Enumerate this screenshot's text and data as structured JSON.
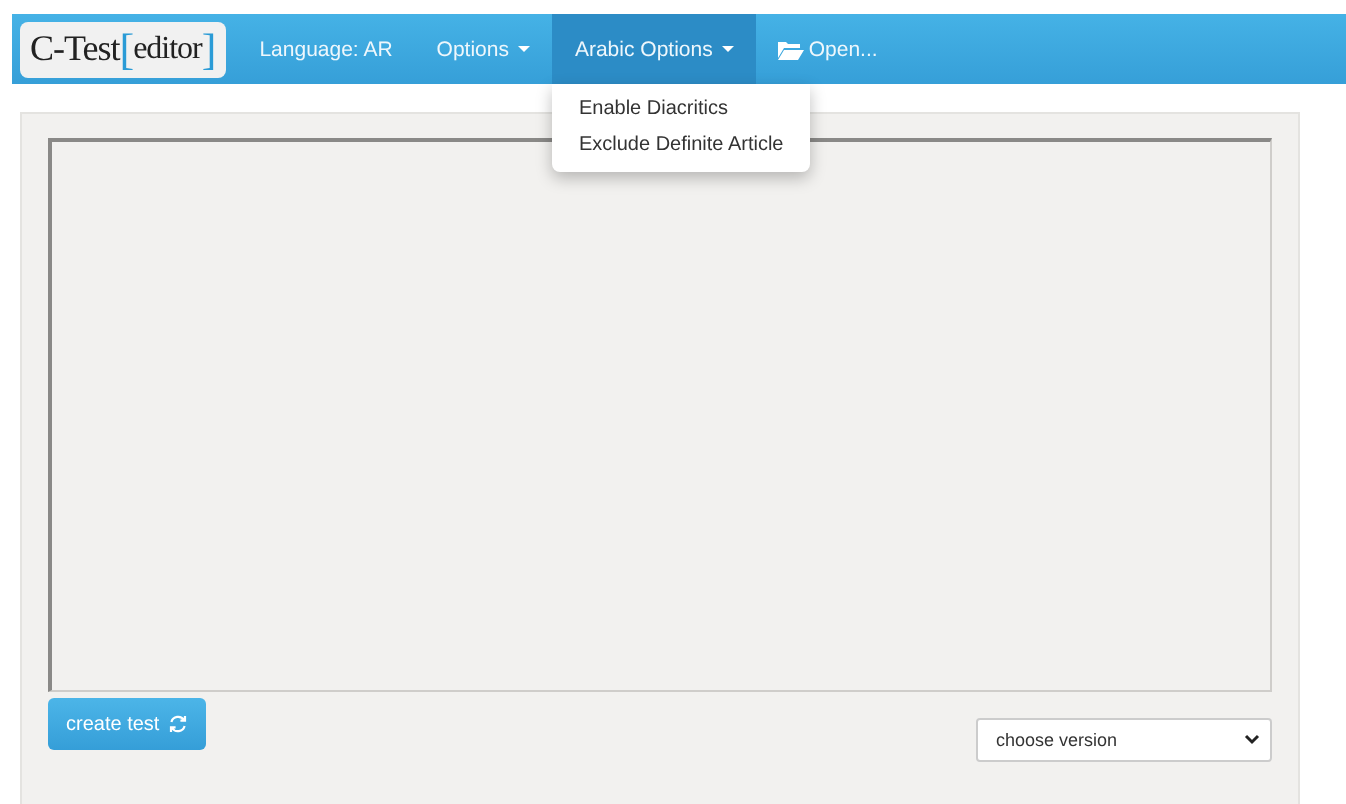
{
  "navbar": {
    "logo": {
      "prefix": "C-Test",
      "open_bracket": "[",
      "word": "editor",
      "close_bracket": "]"
    },
    "items": [
      {
        "label": "Language: AR",
        "kind": "link",
        "expanded": false
      },
      {
        "label": "Options",
        "kind": "dropdown",
        "expanded": false
      },
      {
        "label": "Arabic Options",
        "kind": "dropdown",
        "expanded": true,
        "menu": [
          "Enable Diacritics",
          "Exclude Definite Article"
        ]
      },
      {
        "label": "Open...",
        "kind": "folder-link",
        "expanded": false
      }
    ]
  },
  "create_button": {
    "label": "create test"
  },
  "version_select": {
    "value": "choose version"
  }
}
